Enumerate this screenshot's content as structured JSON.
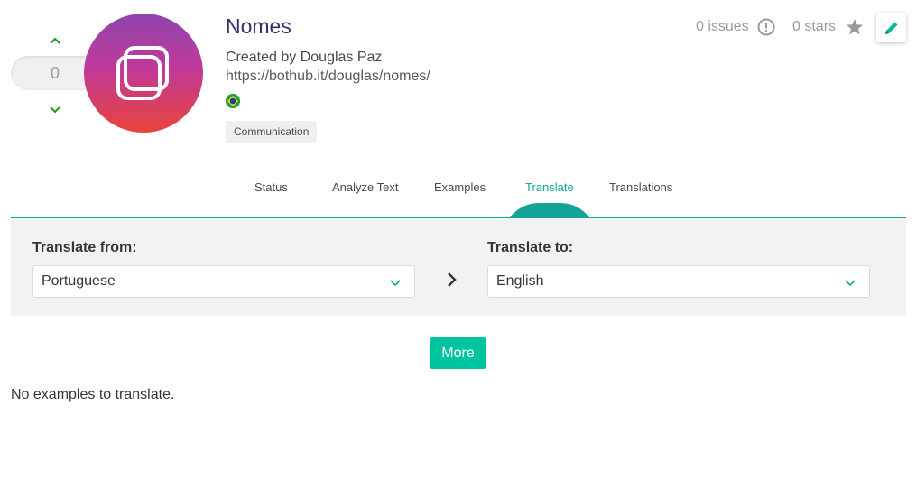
{
  "vote": {
    "count": "0"
  },
  "repository": {
    "name": "Nomes",
    "author_line": "Created by Douglas Paz",
    "url": "https://bothub.it/douglas/nomes/",
    "category": "Communication",
    "issues_label": "0 issues",
    "stars_label": "0 stars"
  },
  "icons": {
    "vote_up": "chevron-up-icon",
    "vote_down": "chevron-down-icon",
    "avatar": "stacked-squares-icon",
    "language_flag": "brazil-flag-icon",
    "issues": "exclamation-circle-icon",
    "star": "star-icon",
    "edit": "pencil-icon",
    "arrow": "chevron-right-icon"
  },
  "tabs": [
    {
      "label": "Status",
      "active": false
    },
    {
      "label": "Analyze Text",
      "active": false
    },
    {
      "label": "Examples",
      "active": false
    },
    {
      "label": "Translate",
      "active": true
    },
    {
      "label": "Translations",
      "active": false
    }
  ],
  "translate": {
    "from_label": "Translate from:",
    "from_value": "Portuguese",
    "to_label": "Translate to:",
    "to_value": "English"
  },
  "more_label": "More",
  "empty_message": "No examples to translate.",
  "colors": {
    "accent": "#17a89a",
    "button": "#00c4a0",
    "vote_arrows": "#1a9c1a",
    "title": "#3b2f6b"
  }
}
